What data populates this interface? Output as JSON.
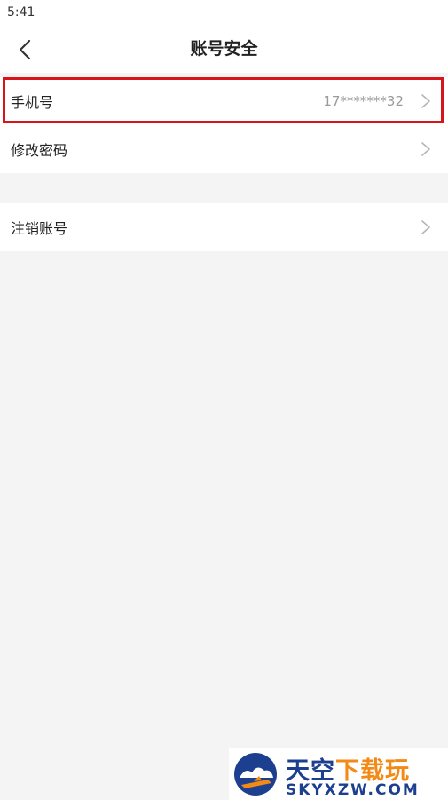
{
  "status_bar": {
    "time": "5:41"
  },
  "header": {
    "title": "账号安全",
    "back_icon": "chevron-left-icon"
  },
  "settings": {
    "phone": {
      "label": "手机号",
      "value": "17*******32"
    },
    "change_password": {
      "label": "修改密码"
    },
    "deactivate_account": {
      "label": "注销账号"
    }
  },
  "watermark": {
    "title_part1": "天空",
    "title_part2": "下载玩",
    "url": "SKYXZW.COM"
  },
  "colors": {
    "highlight_border": "#d7141a",
    "page_background": "#f4f4f4",
    "watermark_blue": "#1d3f8f",
    "watermark_orange": "#f28a15"
  }
}
